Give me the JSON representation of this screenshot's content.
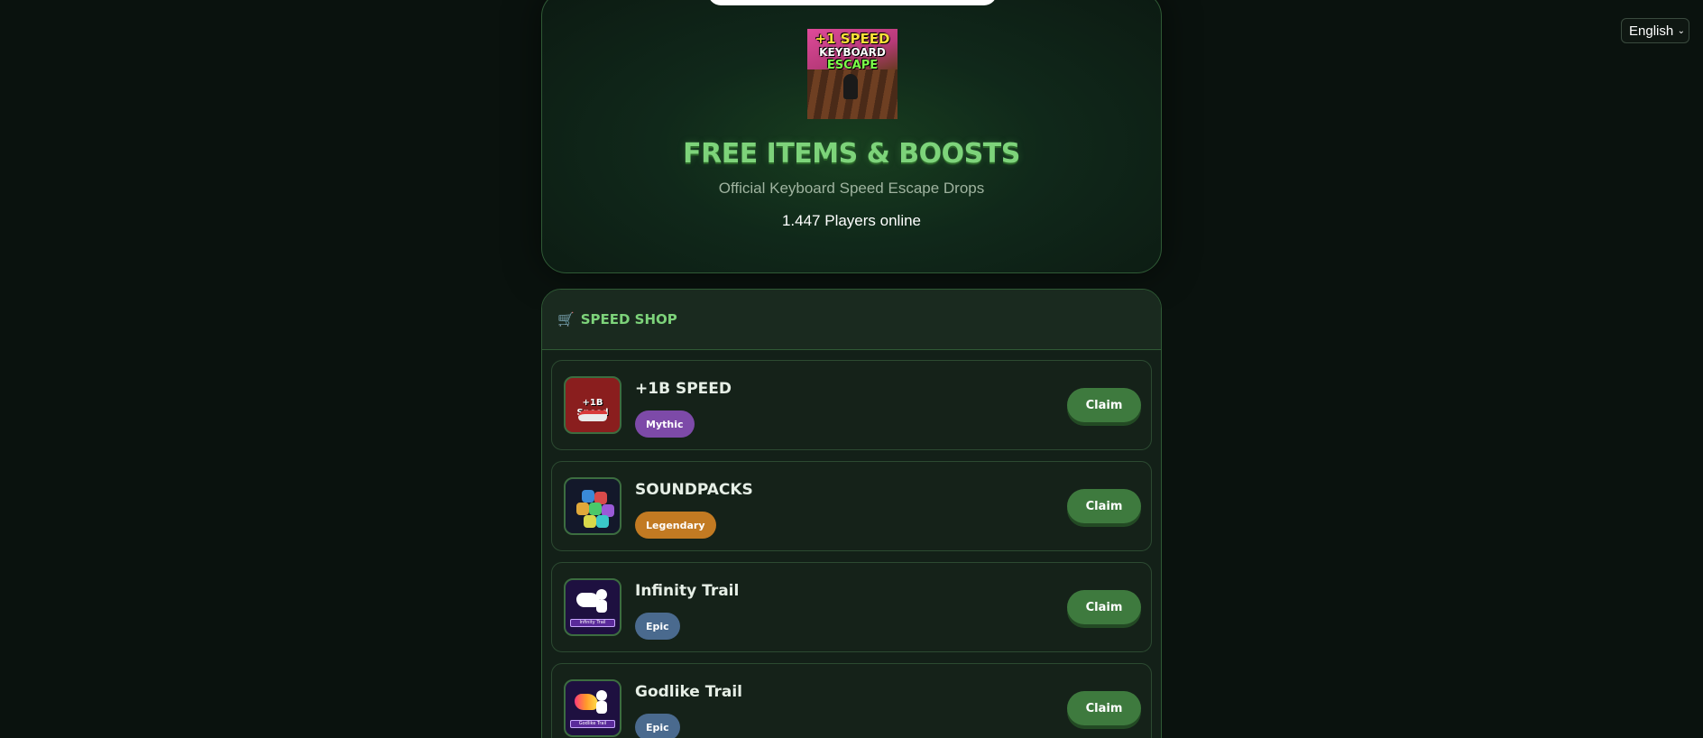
{
  "language_select": {
    "value": "English"
  },
  "hero": {
    "logo_lines": [
      "+1 SPEED",
      "KEYBOARD",
      "ESCAPE"
    ],
    "title": "FREE ITEMS & BOOSTS",
    "subtitle": "Official Keyboard Speed Escape Drops",
    "players_online": "1.447 Players online"
  },
  "shop": {
    "title": "SPEED SHOP",
    "icon": "cart-icon",
    "items": [
      {
        "name": "+1B SPEED",
        "rarity": "Mythic",
        "rarity_color": "#7d4aa8",
        "claim_label": "Claim",
        "thumb_text": "+1B Speed",
        "icon": "speed-shoe-icon"
      },
      {
        "name": "SOUNDPACKS",
        "rarity": "Legendary",
        "rarity_color": "#c27a22",
        "claim_label": "Claim",
        "icon": "soundpacks-icon"
      },
      {
        "name": "Infinity Trail",
        "rarity": "Epic",
        "rarity_color": "#4a6a8e",
        "claim_label": "Claim",
        "thumb_text": "Infinity Trail",
        "icon": "infinity-trail-icon"
      },
      {
        "name": "Godlike Trail",
        "rarity": "Epic",
        "rarity_color": "#4a6a8e",
        "claim_label": "Claim",
        "thumb_text": "Godlike Trail",
        "icon": "godlike-trail-icon"
      }
    ]
  },
  "colors": {
    "accent_green": "#7dd37a",
    "claim_button": "#3e7a3e",
    "background": "#0a120e"
  }
}
